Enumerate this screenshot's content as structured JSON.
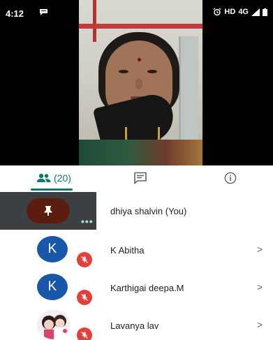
{
  "status_bar": {
    "time": "4:12",
    "right_text": "HD",
    "network": "4G"
  },
  "tabs": [
    {
      "name": "people",
      "label": "(20)",
      "active": true,
      "icon": "people-icon"
    },
    {
      "name": "chat",
      "icon": "chat-icon"
    },
    {
      "name": "info",
      "icon": "info-icon"
    }
  ],
  "participants": [
    {
      "name": "dhiya shalvin (You)",
      "avatar": "pin-icon",
      "self": true
    },
    {
      "name": "K Abitha",
      "initial": "K",
      "muted": true
    },
    {
      "name": "Karthigai deepa.M",
      "initial": "K",
      "muted": true
    },
    {
      "name": "Lavanya lav",
      "avatar": "photo",
      "muted": true
    }
  ],
  "colors": {
    "accent": "#11786b",
    "avatar_blue": "#1958a8",
    "mute_red": "#e0413a",
    "self_tile": "#3c4043"
  }
}
